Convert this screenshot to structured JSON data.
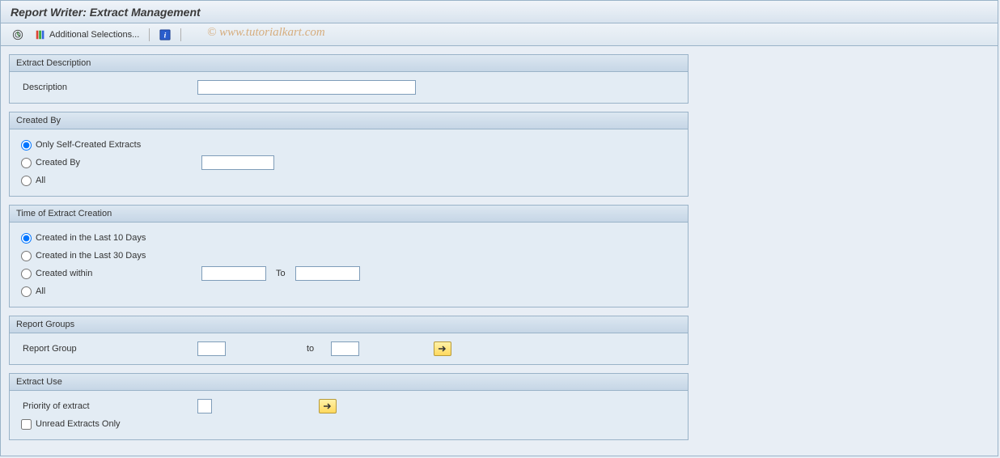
{
  "title": "Report Writer: Extract Management",
  "toolbar": {
    "execute_tooltip": "Execute",
    "selections_label": "Additional Selections...",
    "info_tooltip": "Info"
  },
  "watermark": "© www.tutorialkart.com",
  "groups": {
    "extract_desc": {
      "header": "Extract Description",
      "description_label": "Description",
      "description_value": ""
    },
    "created_by": {
      "header": "Created By",
      "opt_self": "Only Self-Created Extracts",
      "opt_by": "Created By",
      "opt_by_value": "",
      "opt_all": "All"
    },
    "time_creation": {
      "header": "Time of Extract Creation",
      "opt_10": "Created in the Last 10 Days",
      "opt_30": "Created in the Last 30 Days",
      "opt_within": "Created within",
      "opt_within_from": "",
      "to_label": "To",
      "opt_within_to": "",
      "opt_all": "All"
    },
    "report_groups": {
      "header": "Report Groups",
      "label": "Report Group",
      "from_value": "",
      "to_label": "to",
      "to_value": ""
    },
    "extract_use": {
      "header": "Extract Use",
      "priority_label": "Priority of extract",
      "priority_value": "",
      "unread_label": "Unread Extracts Only"
    }
  }
}
